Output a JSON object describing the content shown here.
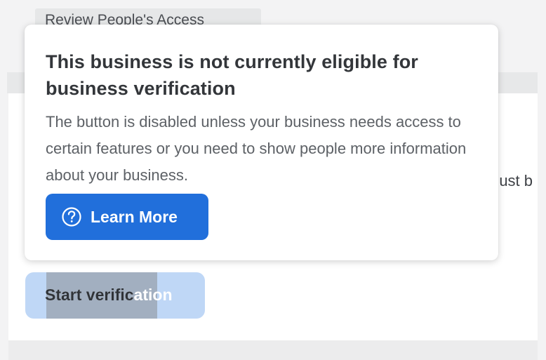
{
  "background": {
    "tab_label": "Review People's Access",
    "clipped_text": "must b",
    "start_button_label": "Start verification"
  },
  "tooltip": {
    "title": "This business is not currently eligible for business verification",
    "body": "The button is disabled unless your business needs access to certain features or you need to show people more information about your business.",
    "learn_more_label": "Learn More",
    "learn_more_icon": "help-circle-icon"
  },
  "colors": {
    "primary": "#216fdb",
    "disabled_button": "#bfd7f6",
    "text_dark": "#33363a",
    "text_muted": "#5d6166"
  }
}
